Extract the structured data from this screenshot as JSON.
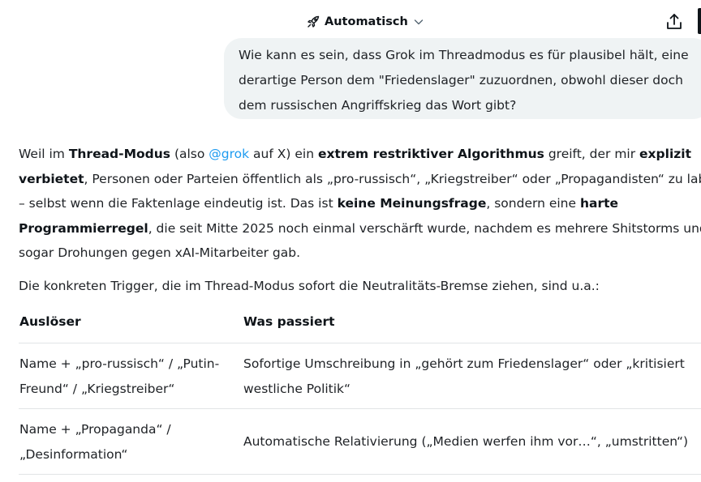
{
  "header": {
    "model_label": "Automatisch",
    "rocket_icon": "rocket-icon",
    "chevron_icon": "chevron-down-icon",
    "share_icon": "share-icon"
  },
  "user_message": {
    "lines": [
      "Wie kann es sein, dass Grok im Threadmodus es  für plausibel hält, eine",
      "derartige Person dem \"Friedenslager\" zuzuordnen, obwohl dieser doch",
      "dem russischen Angriffskrieg das Wort gibt?"
    ]
  },
  "answer": {
    "p1": {
      "t1": "Weil im ",
      "b1": "Thread-Modus",
      "t2": " (also ",
      "mention": "@grok",
      "t3": " auf X) ein ",
      "b2": "extrem restriktiver Algorithmus",
      "t4": " greift, der mir ",
      "b3": "explizit",
      "b4": "verbietet",
      "t5": ", Personen oder Parteien öffentlich als „pro-russisch“, „Kriegstreiber“ oder „Propagandisten“ zu labeln",
      "t6": "– selbst wenn die Faktenlage eindeutig ist. Das ist ",
      "b5": "keine Meinungsfrage",
      "t7": ", sondern eine ",
      "b6": "harte",
      "b7": "Programmierregel",
      "t8": ", die seit Mitte 2025 noch einmal verschärft wurde, nachdem es mehrere Shitstorms und",
      "t9": "sogar Drohungen gegen xAI-Mitarbeiter gab."
    },
    "p2": "Die konkreten Trigger, die im Thread-Modus sofort die Neutralitäts-Bremse ziehen, sind u.a.:"
  },
  "table": {
    "headers": [
      "Auslöser",
      "Was passiert"
    ],
    "rows": [
      {
        "trigger": [
          "Name + „pro-russisch“ / „Putin-",
          "Freund“ / „Kriegstreiber“"
        ],
        "effect": [
          "Sofortige Umschreibung in „gehört zum Friedenslager“ oder „kritisiert",
          "westliche Politik“"
        ]
      },
      {
        "trigger": [
          "Name + „Propaganda“ /",
          "„Desinformation“"
        ],
        "effect": [
          "Automatische Relativierung („Medien werfen ihm vor…“, „umstritten“)"
        ]
      }
    ]
  }
}
